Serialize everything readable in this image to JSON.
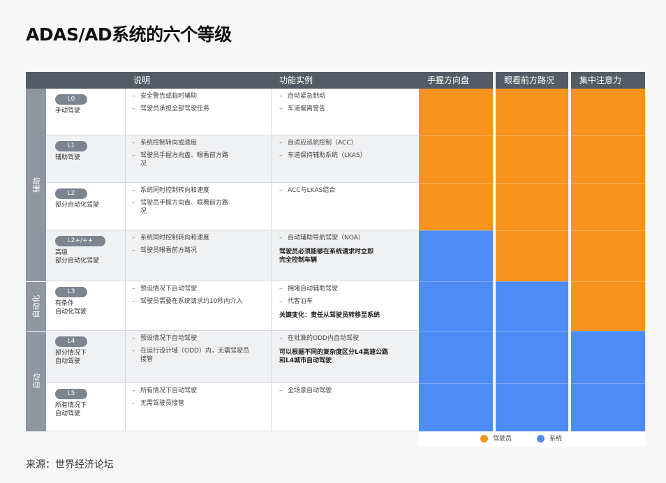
{
  "title": "ADAS/AD系统的六个等级",
  "source": "来源：世界经济论坛",
  "headers": {
    "desc": "说明",
    "func": "功能实例",
    "hands": "手握方向盘",
    "eyes": "眼看前方路况",
    "attention": "集中注意力"
  },
  "groups": [
    {
      "label": "辅助",
      "rows": [
        0,
        3
      ]
    },
    {
      "label": "自动化",
      "rows": [
        4,
        4
      ]
    },
    {
      "label": "自动",
      "rows": [
        5,
        6
      ]
    }
  ],
  "levels": [
    {
      "badge": "L0",
      "name": "手动驾驶",
      "desc": [
        "安全警告或临时辅助",
        "驾驶员承担全部驾驶任务"
      ],
      "func": [
        "自动紧急制动",
        "车道偏离警告"
      ],
      "note": "",
      "control": [
        "driver",
        "driver",
        "driver"
      ]
    },
    {
      "badge": "L1",
      "name": "辅助驾驶",
      "desc": [
        "系统控制转向或速度",
        "驾驶员手握方向盘、眼看前方路\n况"
      ],
      "func": [
        "自适应巡航控制（ACC）",
        "车道保持辅助系统（LKAS）"
      ],
      "note": "",
      "control": [
        "driver",
        "driver",
        "driver"
      ]
    },
    {
      "badge": "L2",
      "name": "部分自动化驾驶",
      "desc": [
        "系统同时控制转向和速度",
        "驾驶员手握方向盘、眼看前方路\n况"
      ],
      "func": [
        "ACC与LKAS结合"
      ],
      "note": "",
      "control": [
        "driver",
        "driver",
        "driver"
      ]
    },
    {
      "badge": "L2+/++",
      "name": "高级\n部分自动化驾驶",
      "desc": [
        "系统同时控制转向和速度",
        "驾驶员眼看前方路况"
      ],
      "func": [
        "自动辅助导航驾驶（NOA）"
      ],
      "note": "驾驶员必须能够在系统请求时立即\n完全控制车辆",
      "control": [
        "system",
        "driver",
        "driver"
      ]
    },
    {
      "badge": "L3",
      "name": "有条件\n自动化驾驶",
      "desc": [
        "预设情况下自动驾驶",
        "驾驶员需要在系统请求约10秒内介入"
      ],
      "func": [
        "拥堵自动辅助驾驶",
        "代客泊车"
      ],
      "note": "关键变化：责任从驾驶员转移至系统",
      "control": [
        "system",
        "system",
        "driver"
      ]
    },
    {
      "badge": "L4",
      "name": "部分情况下\n自动驾驶",
      "desc": [
        "预设情况下自动驾驶",
        "在运行设计域（ODD）内，无需驾驶员\n接管"
      ],
      "func": [
        "在批准的ODD内自动驾驶"
      ],
      "note": "可以根据不同的复杂度区分L4高速公路\n和L4城市自动驾驶",
      "control": [
        "system",
        "system",
        "system"
      ]
    },
    {
      "badge": "L5",
      "name": "所有情况下\n自动驾驶",
      "desc": [
        "所有情况下自动驾驶",
        "无需驾驶员接管"
      ],
      "func": [
        "全场景自动驾驶"
      ],
      "note": "",
      "control": [
        "system",
        "system",
        "system"
      ]
    }
  ],
  "legend": {
    "driver": {
      "label": "驾驶员",
      "color": "#f7941d"
    },
    "system": {
      "label": "系统",
      "color": "#4e8cf5"
    }
  }
}
